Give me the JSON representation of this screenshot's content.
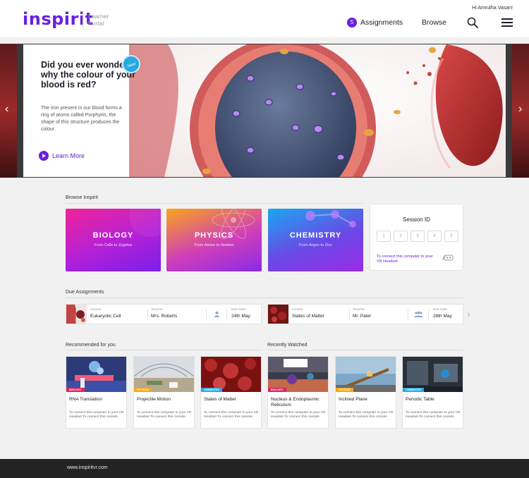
{
  "header": {
    "logo": "inspirit",
    "logo_sub_line1": "Learner",
    "logo_sub_line2": "Portal",
    "greeting": "Hi Amrutha Vasan!",
    "assignments_count": "5",
    "assignments_label": "Assignments",
    "browse_label": "Browse",
    "search_icon": "search-icon",
    "menu_icon": "hamburger-menu-icon"
  },
  "hero": {
    "badge": "New",
    "title": "Did you ever wonder why the colour of your blood is red?",
    "body": "The iron present in our blood forms a ring of atoms called Porphyrin, the shape of this structure produces the colour.",
    "cta": "Learn More",
    "prev_arrow": "‹",
    "next_arrow": "›"
  },
  "browse": {
    "heading": "Browse Inspirit",
    "subjects": [
      {
        "name": "BIOLOGY",
        "sub": "From Cells to Zygotes"
      },
      {
        "name": "PHYSICS",
        "sub": "From Atoms to Newton"
      },
      {
        "name": "CHEMISTRY",
        "sub": "From Argon to Zinc"
      }
    ]
  },
  "session": {
    "title": "Session ID",
    "boxes": [
      "1",
      "2",
      "3",
      "4",
      "5"
    ],
    "connect_text": "To connect this computer to your VR Headset"
  },
  "due": {
    "heading": "Due Assignments",
    "lesson_label": "Lesson",
    "teacher_label": "Teacher",
    "date_label": "Due Date",
    "items": [
      {
        "lesson": "Eukaryotic Cell",
        "teacher": "Mrs. Roberts",
        "date": "24th May"
      },
      {
        "lesson": "States of Matter",
        "teacher": "Mr. Patel",
        "date": "28th May"
      }
    ],
    "next_arrow": "›"
  },
  "recommended": {
    "heading": "Recommended for you",
    "items": [
      {
        "tag": "BIOLOGY",
        "name": "RNA Translation",
        "desc": "To connect this computer to your VR Headset To connect this console"
      },
      {
        "tag": "PHYSICS",
        "name": "Projectile Motion",
        "desc": "To connect this computer to your VR Headset To connect this console"
      },
      {
        "tag": "CHEMISTRY",
        "name": "States of Matter",
        "desc": "To connect this computer to your VR Headset To connect this console"
      }
    ]
  },
  "recent": {
    "heading": "Recently Watched",
    "items": [
      {
        "tag": "BIOLOGY",
        "name": "Nucleus & Endoplasmic Reticulum",
        "desc": "To connect this computer to your VR Headset To connect this console"
      },
      {
        "tag": "PHYSICS",
        "name": "Inclined Plane",
        "desc": "To connect this computer to your VR Headset To connect this console"
      },
      {
        "tag": "CHEMISTRY",
        "name": "Periodic Table",
        "desc": "To connect this computer to your VR Headset To connect this console"
      }
    ]
  },
  "footer": {
    "url": "www.inspiritvr.com"
  },
  "colors": {
    "brand": "#6a1fe0",
    "biology": "#e0245e",
    "physics": "#f4a81d",
    "chemistry": "#29a9e0"
  }
}
